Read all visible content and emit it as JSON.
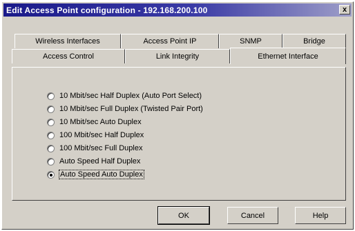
{
  "window": {
    "title": "Edit Access Point configuration - 192.168.200.100",
    "close_label": "x"
  },
  "tabs": {
    "row1": [
      {
        "label": "Wireless Interfaces"
      },
      {
        "label": "Access Point IP"
      },
      {
        "label": "SNMP"
      },
      {
        "label": "Bridge"
      }
    ],
    "row2": [
      {
        "label": "Access Control"
      },
      {
        "label": "Link Integrity"
      },
      {
        "label": "Ethernet Interface"
      }
    ],
    "active": "Ethernet Interface"
  },
  "ethernet": {
    "options": [
      {
        "label": "10 Mbit/sec Half Duplex (Auto Port Select)",
        "selected": false
      },
      {
        "label": "10 Mbit/sec Full Duplex (Twisted Pair Port)",
        "selected": false
      },
      {
        "label": "10 Mbit/sec Auto Duplex",
        "selected": false
      },
      {
        "label": "100 Mbit/sec Half Duplex",
        "selected": false
      },
      {
        "label": "100 Mbit/sec Full Duplex",
        "selected": false
      },
      {
        "label": "Auto Speed Half Duplex",
        "selected": false
      },
      {
        "label": "Auto Speed Auto Duplex",
        "selected": true
      }
    ]
  },
  "buttons": {
    "ok": "OK",
    "cancel": "Cancel",
    "help": "Help"
  }
}
